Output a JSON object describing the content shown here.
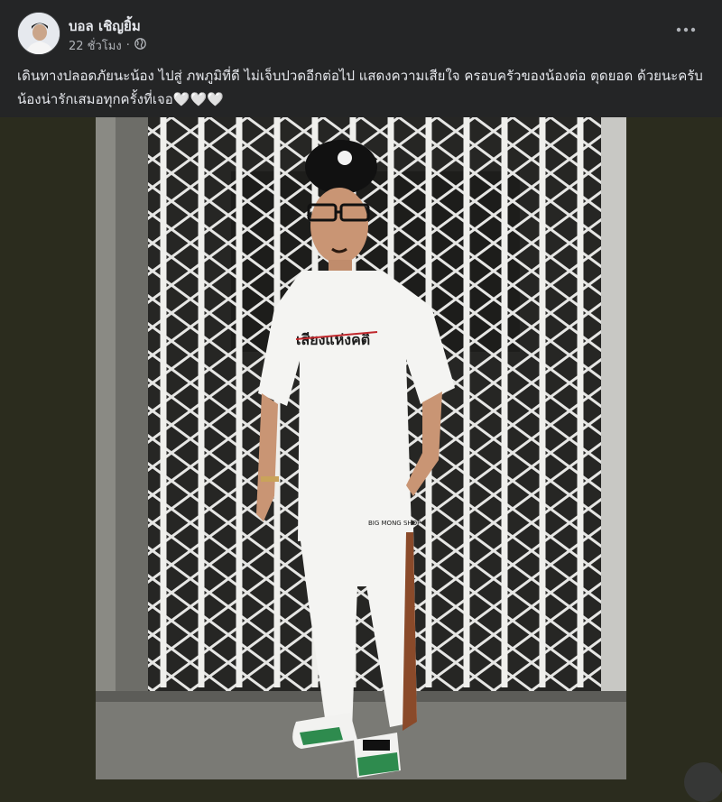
{
  "post": {
    "author": "บอล เชิญยิ้ม",
    "time": "22 ชั่วโมง",
    "separator": "·",
    "privacy_icon": "globe-icon",
    "more_icon": "more-options-icon",
    "text": "เดินทางปลอดภัยนะน้อง ไปสู่ ภพภูมิที่ดี ไม่เจ็บปวดอีกต่อไป แสดงความเสียใจ ครอบครัวของน้องต่อ ตุดยอด ด้วยนะครับ น้องน่ารักเสมอทุกครั้งที่เจอ🤍🤍🤍"
  },
  "photo": {
    "shirt_text": "เสียงแห่งคติ",
    "pants_text": "BIG MONG SHOP"
  },
  "colors": {
    "header_bg": "#242526",
    "text_primary": "#e4e6eb",
    "text_secondary": "#b0b3b8",
    "photo_bg": "#2b2c1e"
  }
}
